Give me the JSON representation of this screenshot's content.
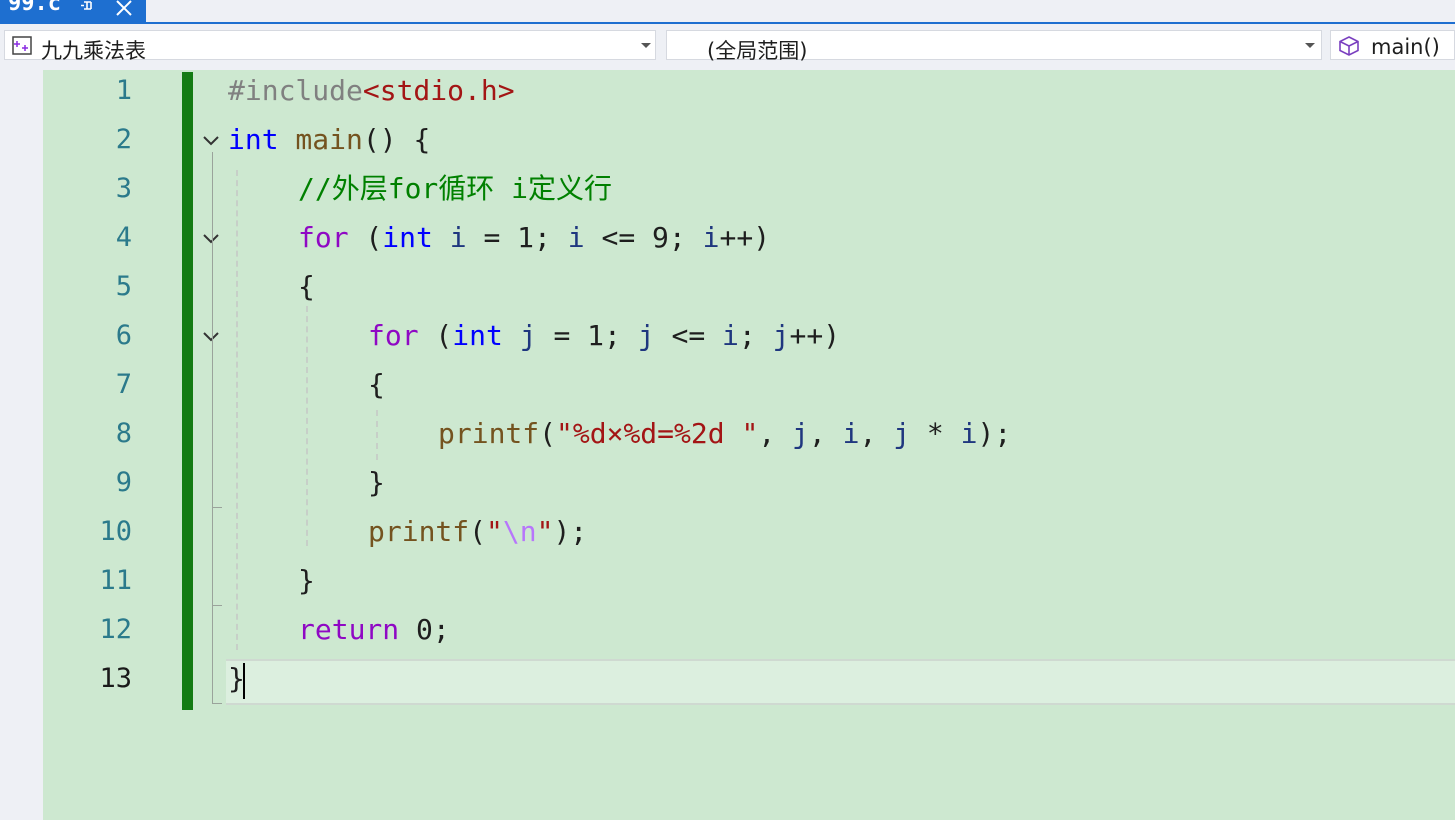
{
  "tab": {
    "title": "99.c",
    "pin_icon": "pin-icon",
    "close_icon": "close-icon"
  },
  "navbar": {
    "project": "九九乘法表",
    "scope": "(全局范围)",
    "member": "main()"
  },
  "editor": {
    "line_numbers": [
      "1",
      "2",
      "3",
      "4",
      "5",
      "6",
      "7",
      "8",
      "9",
      "10",
      "11",
      "12",
      "13"
    ],
    "lines": {
      "l1": {
        "pp": "#include",
        "hdr": "<stdio.h>"
      },
      "l2": {
        "kw": "int",
        "fn": " main",
        "rest": "() {"
      },
      "l3": {
        "comment": "//外层for循环 i定义行"
      },
      "l4": {
        "kw": "for",
        "p1": " (",
        "kw2": "int",
        "v1": " i",
        "p2": " = 1; ",
        "v2": "i",
        "p3": " <= 9; ",
        "v3": "i",
        "p4": "++)"
      },
      "l5": {
        "text": "{"
      },
      "l6": {
        "kw": "for",
        "p1": " (",
        "kw2": "int",
        "v1": " j",
        "p2": " = 1; ",
        "v2": "j",
        "p3": " <= ",
        "v3": "i",
        "p4": "; ",
        "v4": "j",
        "p5": "++)"
      },
      "l7": {
        "text": "{"
      },
      "l8": {
        "fn": "printf",
        "p1": "(",
        "str": "\"%d×%d=%2d \"",
        "p2": ", ",
        "v1": "j",
        "p3": ", ",
        "v2": "i",
        "p4": ", ",
        "v3": "j",
        "p5": " * ",
        "v4": "i",
        "p6": ");"
      },
      "l9": {
        "text": "}"
      },
      "l10": {
        "fn": "printf",
        "p1": "(",
        "q1": "\"",
        "esc": "\\n",
        "q2": "\"",
        "p2": ");"
      },
      "l11": {
        "text": "}"
      },
      "l12": {
        "kw": "return",
        "rest": " 0;"
      },
      "l13": {
        "text": "}"
      }
    }
  }
}
